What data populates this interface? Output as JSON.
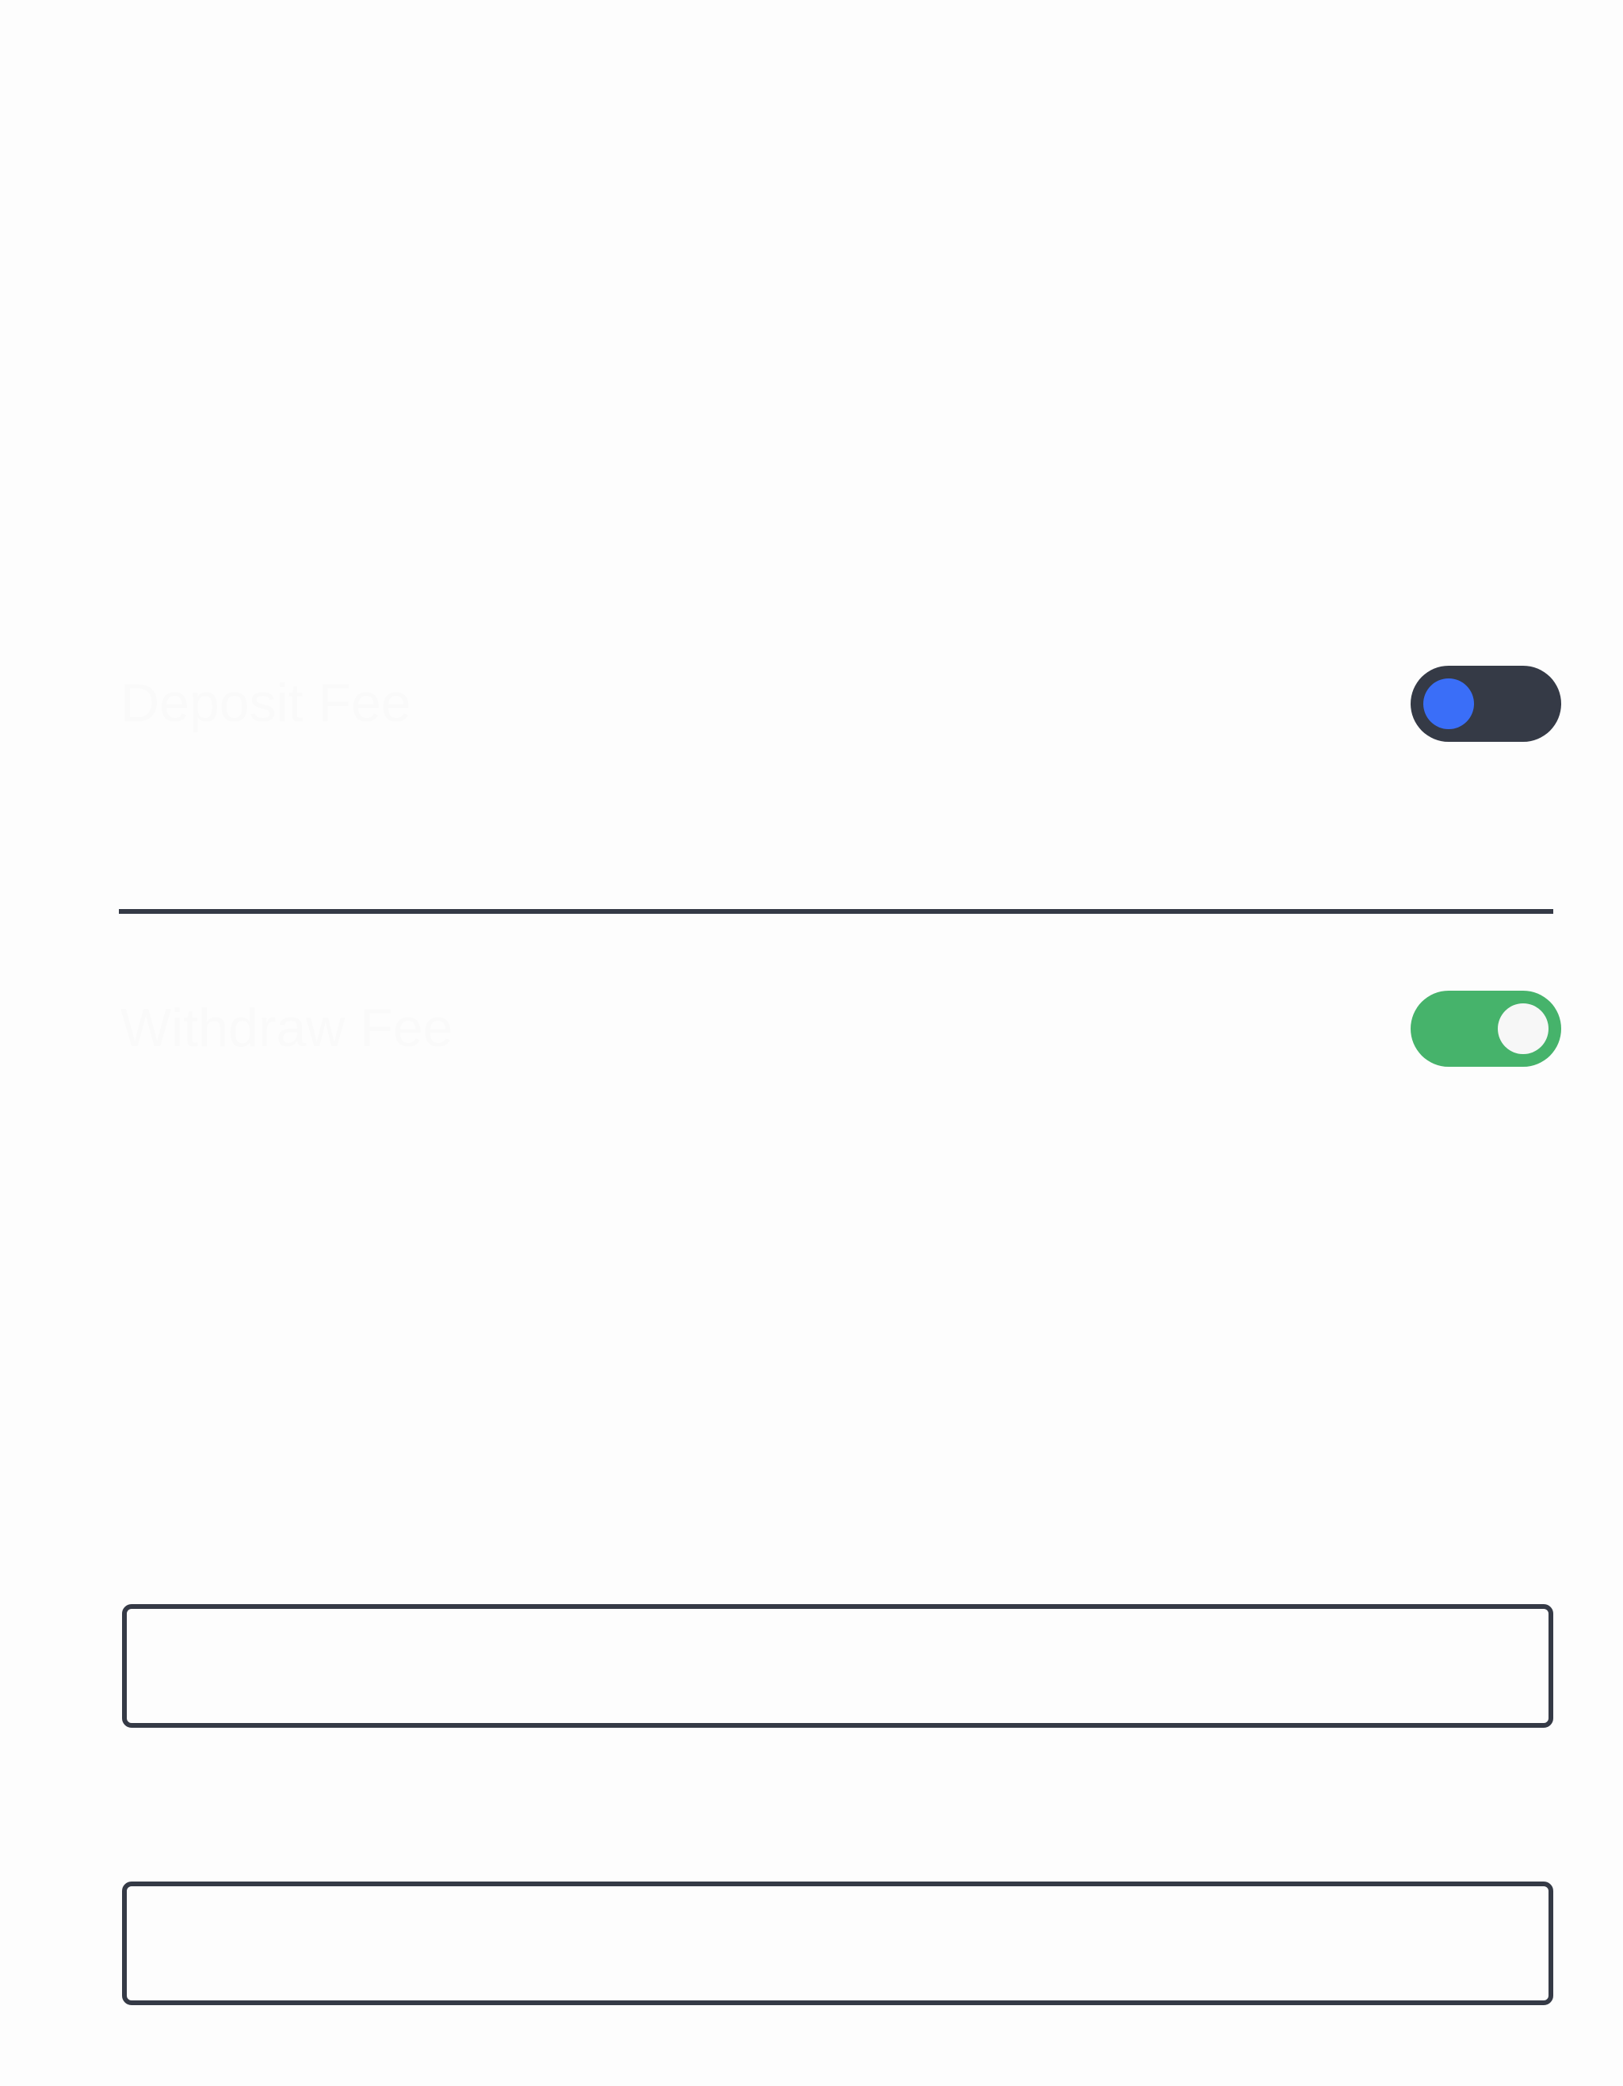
{
  "fees": [
    {
      "label": "Deposit Fee",
      "enabled": false,
      "knob_color": "#3a6ef8",
      "track_color": "#353a46"
    },
    {
      "label": "Withdraw Fee",
      "enabled": true,
      "knob_color": "#f7f7f7",
      "track_color": "#46b36b"
    }
  ],
  "inputs": [
    {
      "value": "",
      "placeholder": ""
    },
    {
      "value": "",
      "placeholder": ""
    }
  ],
  "colors": {
    "background": "#fdfdfd",
    "border": "#353a46",
    "label_text": "#fafafa",
    "toggle_on": "#46b36b",
    "toggle_off": "#353a46",
    "knob_off": "#3a6ef8"
  }
}
